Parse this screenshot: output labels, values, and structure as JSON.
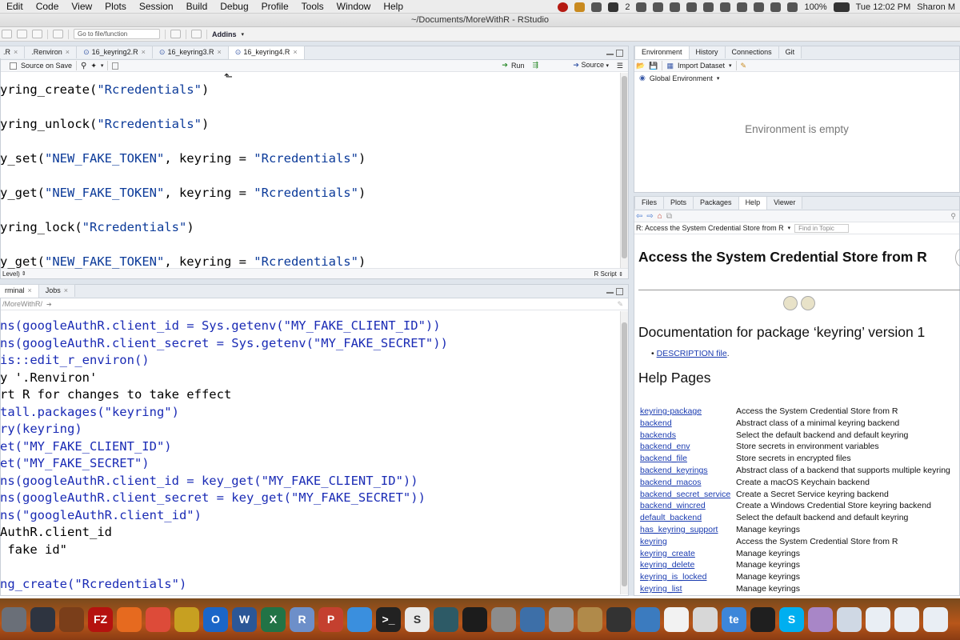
{
  "menubar": {
    "items": [
      "Edit",
      "Code",
      "View",
      "Plots",
      "Session",
      "Build",
      "Debug",
      "Profile",
      "Tools",
      "Window",
      "Help"
    ],
    "badge": "2",
    "battery": "100%",
    "clock": "Tue 12:02 PM",
    "user": "Sharon M"
  },
  "window": {
    "title": "~/Documents/MoreWithR - RStudio"
  },
  "toolbar": {
    "goto_placeholder": "Go to file/function",
    "addins_label": "Addins"
  },
  "source": {
    "tabs": [
      {
        "label": ".R",
        "active": false
      },
      {
        "label": ".Renviron",
        "active": false
      },
      {
        "label": "16_keyring2.R",
        "active": false
      },
      {
        "label": "16_keyring3.R",
        "active": false
      },
      {
        "label": "16_keyring4.R",
        "active": true
      }
    ],
    "source_on_save": "Source on Save",
    "run_label": "Run",
    "source_label": "Source",
    "status_left": "Level)",
    "status_right": "R Script",
    "lines": [
      {
        "pre": "yring_create(",
        "str": "\"Rcredentials\"",
        "post": ")"
      },
      {
        "pre": "yring_unlock(",
        "str": "\"Rcredentials\"",
        "post": ")"
      },
      {
        "pre": "y_set(",
        "str": "\"NEW_FAKE_TOKEN\"",
        "post": ", keyring = ",
        "str2": "\"Rcredentials\"",
        "post2": ")"
      },
      {
        "pre": "y_get(",
        "str": "\"NEW_FAKE_TOKEN\"",
        "post": ", keyring = ",
        "str2": "\"Rcredentials\"",
        "post2": ")"
      },
      {
        "pre": "yring_lock(",
        "str": "\"Rcredentials\"",
        "post": ")"
      },
      {
        "pre": "y_get(",
        "str": "\"NEW_FAKE_TOKEN\"",
        "post": ", keyring = ",
        "str2": "\"Rcredentials\"",
        "post2": ")"
      }
    ]
  },
  "console": {
    "tabs": [
      "rminal",
      "Jobs"
    ],
    "path": "/MoreWithR/",
    "lines": [
      {
        "text": "ns(googleAuthR.client_id = Sys.getenv(\"MY_FAKE_CLIENT_ID\"))",
        "kind": "cmd"
      },
      {
        "text": "ns(googleAuthR.client_secret = Sys.getenv(\"MY_FAKE_SECRET\"))",
        "kind": "cmd"
      },
      {
        "text": "is::edit_r_environ()",
        "kind": "cmd"
      },
      {
        "text": "y '.Renviron'",
        "kind": "out"
      },
      {
        "text": "rt R for changes to take effect",
        "kind": "out"
      },
      {
        "text": "tall.packages(\"keyring\")",
        "kind": "cmd"
      },
      {
        "text": "ry(keyring)",
        "kind": "cmd"
      },
      {
        "text": "et(\"MY_FAKE_CLIENT_ID\")",
        "kind": "cmd"
      },
      {
        "text": "et(\"MY_FAKE_SECRET\")",
        "kind": "cmd"
      },
      {
        "text": "ns(googleAuthR.client_id = key_get(\"MY_FAKE_CLIENT_ID\"))",
        "kind": "cmd"
      },
      {
        "text": "ns(googleAuthR.client_secret = key_get(\"MY_FAKE_SECRET\"))",
        "kind": "cmd"
      },
      {
        "text": "ns(\"googleAuthR.client_id\")",
        "kind": "cmd"
      },
      {
        "text": "AuthR.client_id",
        "kind": "out"
      },
      {
        "text": " fake id\"",
        "kind": "out"
      },
      {
        "text": "",
        "kind": "out"
      },
      {
        "text": "ng_create(\"Rcredentials\")",
        "kind": "cmd"
      }
    ]
  },
  "environment": {
    "tabs": [
      "Environment",
      "History",
      "Connections",
      "Git"
    ],
    "import_label": "Import Dataset",
    "scope_label": "Global Environment",
    "empty_message": "Environment is empty"
  },
  "help": {
    "tabs": [
      "Files",
      "Plots",
      "Packages",
      "Help",
      "Viewer"
    ],
    "topic_label": "R: Access the System Credential Store from R",
    "find_placeholder": "Find in Topic",
    "heading": "Access the System Credential Store from R",
    "doc_title": "Documentation for package ‘keyring’ version 1",
    "description_link": "DESCRIPTION file",
    "help_pages_heading": "Help Pages",
    "pages": [
      {
        "name": "keyring-package",
        "desc": "Access the System Credential Store from R"
      },
      {
        "name": "backend",
        "desc": "Abstract class of a minimal keyring backend"
      },
      {
        "name": "backends",
        "desc": "Select the default backend and default keyring"
      },
      {
        "name": "backend_env",
        "desc": "Store secrets in environment variables"
      },
      {
        "name": "backend_file",
        "desc": "Store secrets in encrypted files"
      },
      {
        "name": "backend_keyrings",
        "desc": "Abstract class of a backend that supports multiple keyring"
      },
      {
        "name": "backend_macos",
        "desc": "Create a macOS Keychain backend"
      },
      {
        "name": "backend_secret_service",
        "desc": "Create a Secret Service keyring backend"
      },
      {
        "name": "backend_wincred",
        "desc": "Create a Windows Credential Store keyring backend"
      },
      {
        "name": "default_backend",
        "desc": "Select the default backend and default keyring"
      },
      {
        "name": "has_keyring_support",
        "desc": "Manage keyrings"
      },
      {
        "name": "keyring",
        "desc": "Access the System Credential Store from R"
      },
      {
        "name": "keyring_create",
        "desc": "Manage keyrings"
      },
      {
        "name": "keyring_delete",
        "desc": "Manage keyrings"
      },
      {
        "name": "keyring_is_locked",
        "desc": "Manage keyrings"
      },
      {
        "name": "keyring_list",
        "desc": "Manage keyrings"
      }
    ]
  },
  "dock": {
    "apps": [
      {
        "icon": "rocket-icon",
        "color": "#6a6f78",
        "glyph": ""
      },
      {
        "icon": "mission-control-icon",
        "color": "#2e3440",
        "glyph": ""
      },
      {
        "icon": "chrome-alt-icon",
        "color": "#7a3e1a",
        "glyph": ""
      },
      {
        "icon": "filezilla-icon",
        "color": "#b5120f",
        "glyph": "FZ"
      },
      {
        "icon": "firefox-icon",
        "color": "#e66a1f",
        "glyph": ""
      },
      {
        "icon": "chrome-icon",
        "color": "#dd4b39",
        "glyph": ""
      },
      {
        "icon": "wunderlist-icon",
        "color": "#c7a021",
        "glyph": ""
      },
      {
        "icon": "outlook-icon",
        "color": "#1b66c8",
        "glyph": "O"
      },
      {
        "icon": "word-icon",
        "color": "#2b5797",
        "glyph": "W"
      },
      {
        "icon": "excel-icon",
        "color": "#217346",
        "glyph": "X"
      },
      {
        "icon": "rstudio-icon",
        "color": "#6d8fc9",
        "glyph": "R"
      },
      {
        "icon": "powerpoint-icon",
        "color": "#c4402f",
        "glyph": "P"
      },
      {
        "icon": "safari-icon",
        "color": "#3a8fde",
        "glyph": ""
      },
      {
        "icon": "terminal-icon",
        "color": "#222",
        "glyph": ">_"
      },
      {
        "icon": "scrivener-icon",
        "color": "#e9e9e9",
        "glyph": "S"
      },
      {
        "icon": "time-machine-icon",
        "color": "#2d5a66",
        "glyph": ""
      },
      {
        "icon": "activity-monitor-icon",
        "color": "#1c1c1c",
        "glyph": ""
      },
      {
        "icon": "system-preferences-icon",
        "color": "#8c8c8c",
        "glyph": ""
      },
      {
        "icon": "xcode-icon",
        "color": "#3d6fa8",
        "glyph": ""
      },
      {
        "icon": "calculator-icon",
        "color": "#9a9a9a",
        "glyph": ""
      },
      {
        "icon": "compass-icon",
        "color": "#b08a4a",
        "glyph": ""
      },
      {
        "icon": "console-icon",
        "color": "#333",
        "glyph": ""
      },
      {
        "icon": "vpn-icon",
        "color": "#3b7bbf",
        "glyph": ""
      },
      {
        "icon": "notes-icon",
        "color": "#f2f2f2",
        "glyph": ""
      },
      {
        "icon": "textexpander-icon",
        "color": "#d7d7d7",
        "glyph": ""
      },
      {
        "icon": "teams-icon",
        "color": "#3d86d9",
        "glyph": "te"
      },
      {
        "icon": "obs-icon",
        "color": "#1f1f1f",
        "glyph": ""
      },
      {
        "icon": "skype-icon",
        "color": "#00aff0",
        "glyph": "S"
      },
      {
        "icon": "preview-icon",
        "color": "#a886c7",
        "glyph": ""
      },
      {
        "icon": "finder-folder-icon",
        "color": "#cfd8e4",
        "glyph": ""
      },
      {
        "icon": "document-icon",
        "color": "#e9eef4",
        "glyph": ""
      },
      {
        "icon": "document2-icon",
        "color": "#e9eef4",
        "glyph": ""
      },
      {
        "icon": "document3-icon",
        "color": "#e9eef4",
        "glyph": ""
      }
    ]
  }
}
